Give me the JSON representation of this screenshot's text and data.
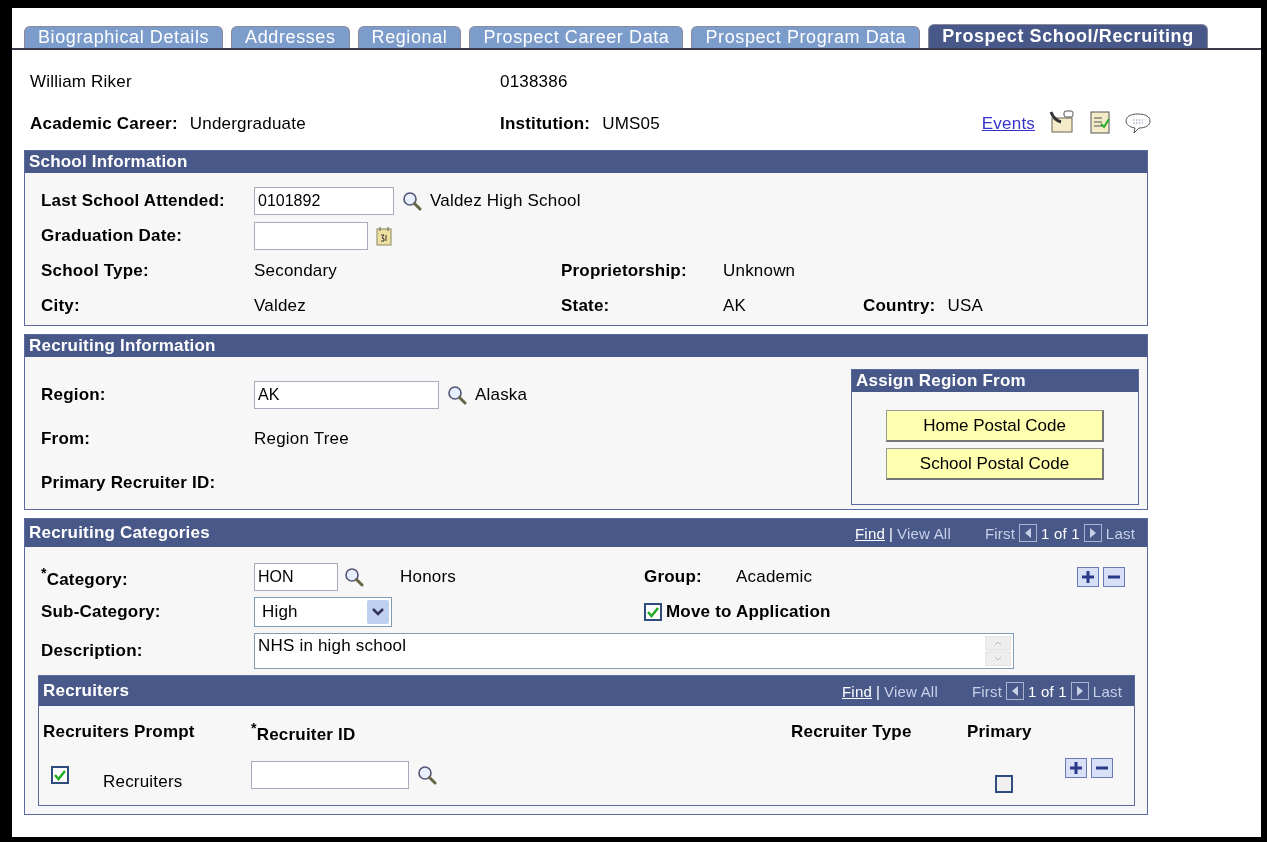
{
  "tabs": [
    {
      "label": "Biographical Details",
      "selected": false
    },
    {
      "label": "Addresses",
      "selected": false
    },
    {
      "label": "Regional",
      "selected": false
    },
    {
      "label": "Prospect Career Data",
      "selected": false
    },
    {
      "label": "Prospect Program Data",
      "selected": false
    },
    {
      "label": "Prospect School/Recruiting",
      "selected": true
    }
  ],
  "header": {
    "name": "William Riker",
    "id": "0138386",
    "academic_career": {
      "label": "Academic Career:",
      "value": "Undergraduate"
    },
    "institution": {
      "label": "Institution:",
      "value": "UMS05"
    },
    "events_link": "Events"
  },
  "school_information": {
    "title": "School Information",
    "last_school": {
      "label": "Last School Attended:",
      "value": "0101892",
      "description": "Valdez High School"
    },
    "graduation_date": {
      "label": "Graduation Date:"
    },
    "school_type": {
      "label": "School Type:",
      "value": "Secondary"
    },
    "proprietorship": {
      "label": "Proprietorship:",
      "value": "Unknown"
    },
    "city": {
      "label": "City:",
      "value": "Valdez"
    },
    "state": {
      "label": "State:",
      "value": "AK"
    },
    "country": {
      "label": "Country:",
      "value": "USA"
    }
  },
  "recruiting_information": {
    "title": "Recruiting Information",
    "region": {
      "label": "Region:",
      "value": "AK",
      "description": "Alaska"
    },
    "from": {
      "label": "From:",
      "value": "Region Tree"
    },
    "primary_recruiter_id": {
      "label": "Primary Recruiter ID:"
    },
    "assign_region_from": {
      "title": "Assign Region From",
      "buttons": [
        "Home Postal Code",
        "School Postal Code"
      ]
    }
  },
  "recruiting_categories": {
    "title": "Recruiting Categories",
    "nav": {
      "find": "Find",
      "separator": "|",
      "view_all": "View All",
      "first": "First",
      "position": "1 of 1",
      "last": "Last"
    },
    "category": {
      "label": "$^{*}$Category:",
      "value": "HON",
      "description": "Honors"
    },
    "group": {
      "label": "Group:",
      "value": "Academic"
    },
    "sub_category": {
      "label": "Sub-Category:",
      "value": "High"
    },
    "move_to_application": {
      "label": "Move to Application",
      "checked": true
    },
    "description": {
      "label": "Description:",
      "value": "NHS in high school"
    },
    "recruiters": {
      "title": "Recruiters",
      "nav": {
        "find": "Find",
        "separator": "|",
        "view_all": "View All",
        "first": "First",
        "position": "1 of 1",
        "last": "Last"
      },
      "columns": [
        "Recruiters Prompt",
        "$^{*}$Recruiter ID",
        "Recruiter Type",
        "Primary"
      ],
      "rows": [
        {
          "prompt_checked": true,
          "prompt_label": "Recruiters",
          "primary_checked": false
        }
      ]
    }
  }
}
